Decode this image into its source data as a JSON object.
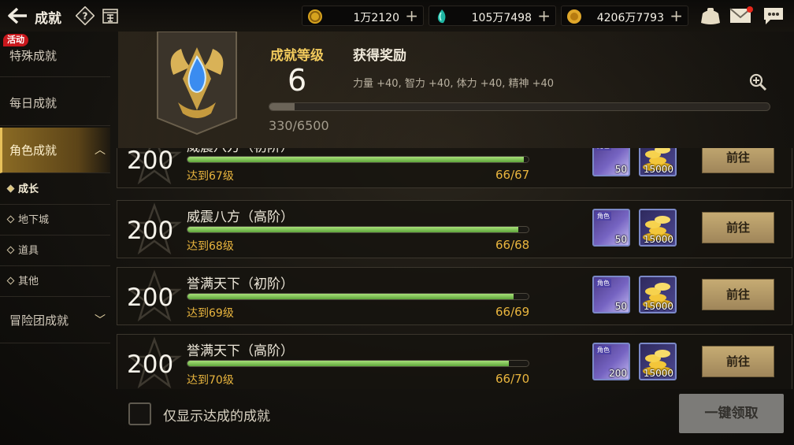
{
  "topbar": {
    "title": "成就",
    "currencies": [
      {
        "icon": "gold-coin-icon",
        "value": "1万2120"
      },
      {
        "icon": "crystal-icon",
        "value": "105万7498"
      },
      {
        "icon": "gold-coin-stack-icon",
        "value": "4206万7793"
      }
    ]
  },
  "sidebar": {
    "event_badge": "活动",
    "items": [
      {
        "label": "特殊成就"
      },
      {
        "label": "每日成就"
      },
      {
        "label": "角色成就"
      },
      {
        "label": "冒险团成就"
      }
    ],
    "subitems": [
      {
        "label": "成长"
      },
      {
        "label": "地下城"
      },
      {
        "label": "道具"
      },
      {
        "label": "其他"
      }
    ]
  },
  "header": {
    "level_label": "成就等级",
    "level": "6",
    "reward_label": "获得奖励",
    "reward_desc": "力量 +40, 智力 +40, 体力 +40, 精神 +40",
    "xp_text": "330/6500",
    "xp_fraction": 0.0508
  },
  "achievements": [
    {
      "points": "200",
      "name": "威震八方（初阶）",
      "condition": "达到67级",
      "progress": "66/67",
      "fraction": 0.985,
      "rewards": [
        {
          "icon": "role-ticket-icon",
          "tag": "角色",
          "count": "50"
        },
        {
          "icon": "gold-coin-icon",
          "count": "15000"
        }
      ],
      "button": "前往"
    },
    {
      "points": "200",
      "name": "威震八方（高阶）",
      "condition": "达到68级",
      "progress": "66/68",
      "fraction": 0.97,
      "rewards": [
        {
          "icon": "role-ticket-icon",
          "tag": "角色",
          "count": "50"
        },
        {
          "icon": "gold-coin-icon",
          "count": "15000"
        }
      ],
      "button": "前往"
    },
    {
      "points": "200",
      "name": "誉满天下（初阶）",
      "condition": "达到69级",
      "progress": "66/69",
      "fraction": 0.957,
      "rewards": [
        {
          "icon": "role-ticket-icon",
          "tag": "角色",
          "count": "50"
        },
        {
          "icon": "gold-coin-icon",
          "count": "15000"
        }
      ],
      "button": "前往"
    },
    {
      "points": "200",
      "name": "誉满天下（高阶）",
      "condition": "达到70级",
      "progress": "66/70",
      "fraction": 0.943,
      "rewards": [
        {
          "icon": "role-ticket-icon",
          "tag": "角色",
          "count": "200"
        },
        {
          "icon": "gold-coin-icon",
          "count": "15000"
        }
      ],
      "button": "前往"
    }
  ],
  "footer": {
    "filter_label": "仅显示达成的成就",
    "claim_all": "一键领取"
  },
  "colors": {
    "accent_gold": "#f0c95c",
    "progress_green": "#7ccc52",
    "condition_orange": "#e9b53e"
  }
}
